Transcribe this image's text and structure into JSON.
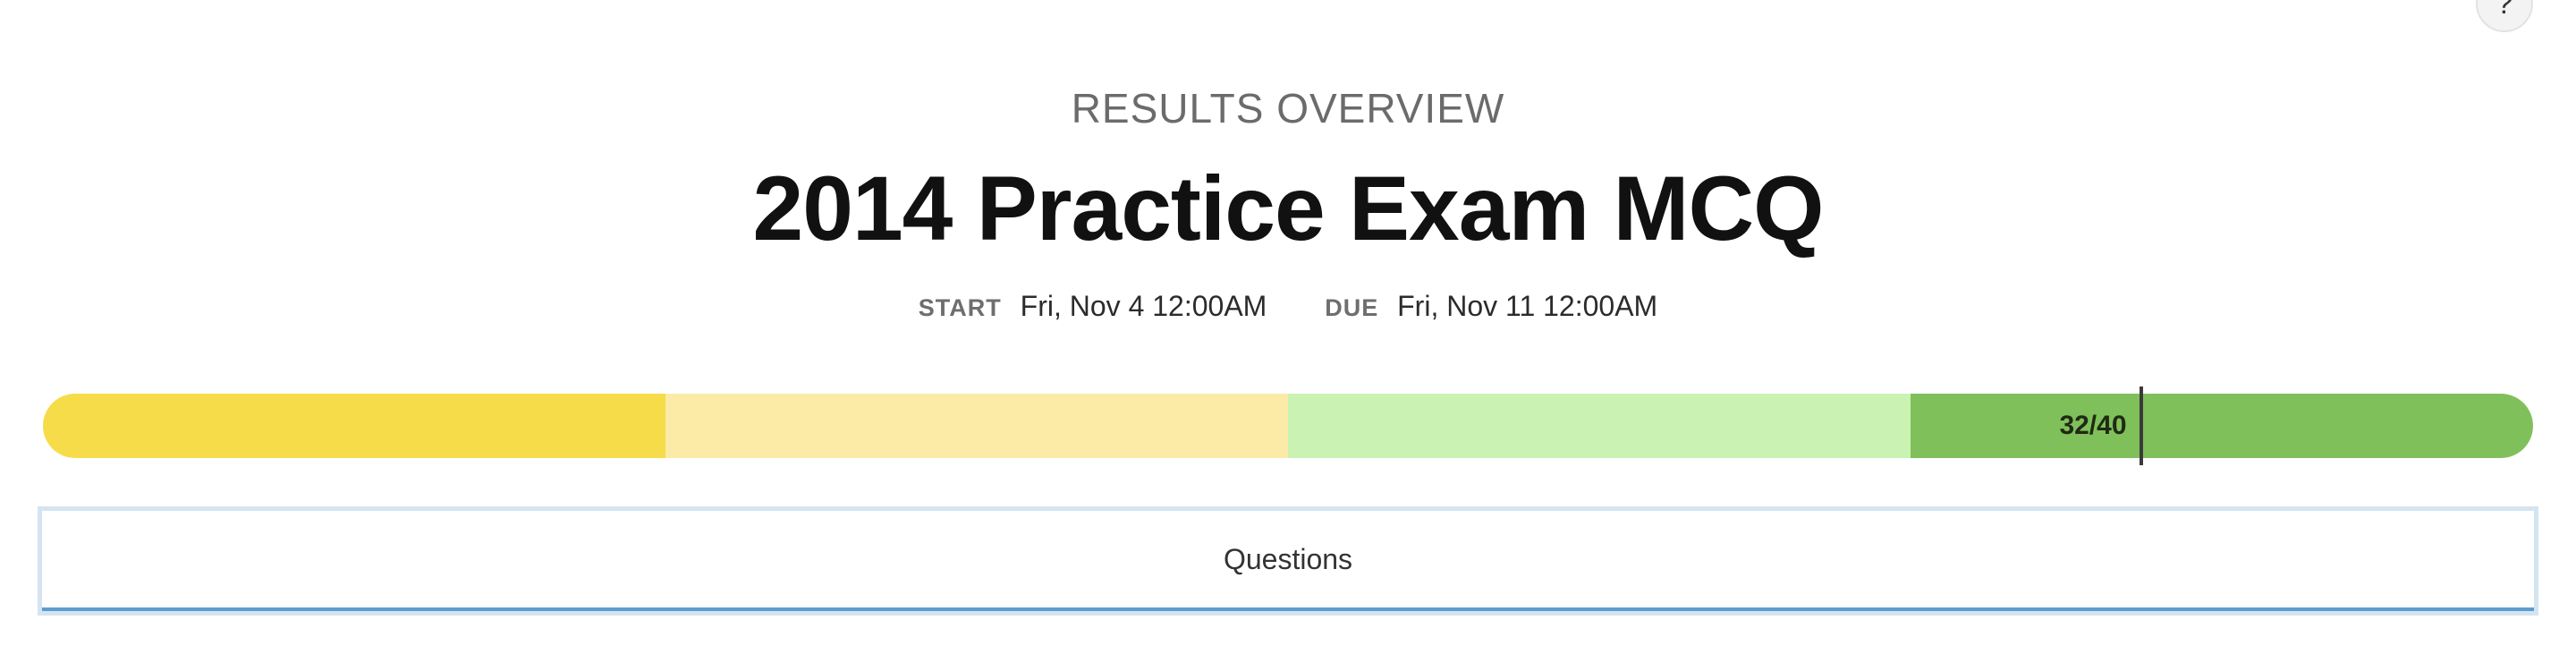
{
  "help": {
    "label": "?"
  },
  "header": {
    "subtitle": "RESULTS OVERVIEW",
    "title": "2014 Practice Exam MCQ",
    "start_label": "START",
    "start_value": "Fri, Nov 4 12:00AM",
    "due_label": "DUE",
    "due_value": "Fri, Nov 11 12:00AM"
  },
  "score_bar": {
    "score_text": "32/40",
    "score": 32,
    "total": 40,
    "segments": [
      {
        "name": "segment-1",
        "color": "#f7dc4a"
      },
      {
        "name": "segment-2",
        "color": "#fbeba6"
      },
      {
        "name": "segment-3",
        "color": "#caf2b3"
      },
      {
        "name": "segment-4",
        "color": "#80c05a"
      }
    ]
  },
  "tabs": {
    "questions_label": "Questions"
  }
}
